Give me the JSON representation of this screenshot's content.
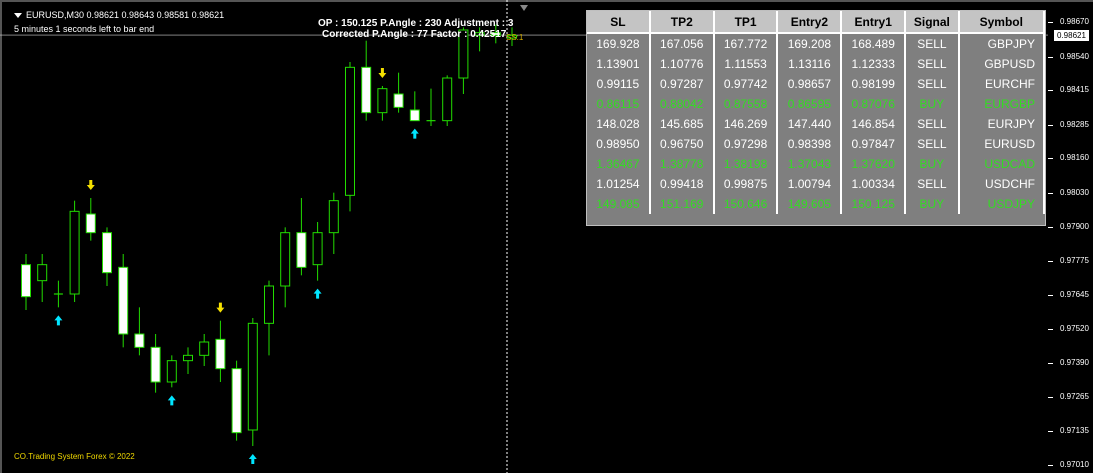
{
  "header": {
    "symbol_line": "EURUSD,M30  0.98621  0.98643  0.98581  0.98621",
    "timer_line": "5 minutes 1 seconds left to bar end"
  },
  "info": {
    "op_line": "OP : 150.125   P.Angle : 230   Adjustment : 3",
    "corrected_line": "Corrected P.Angle : 77   Factor : 0.42517"
  },
  "ss_label": "SS:1",
  "copyright": "CO.Trading System Forex © 2022",
  "current_price": "0.98621",
  "price_axis": {
    "labels": [
      "0.98670",
      "0.98540",
      "0.98415",
      "0.98285",
      "0.98160",
      "0.98030",
      "0.97900",
      "0.97775",
      "0.97645",
      "0.97520",
      "0.97390",
      "0.97265",
      "0.97135",
      "0.97010"
    ]
  },
  "signal_table": {
    "headers": [
      "SL",
      "TP2",
      "TP1",
      "Entry2",
      "Entry1",
      "Signal",
      "Symbol"
    ],
    "rows": [
      {
        "type": "sell",
        "cells": [
          "169.928",
          "167.056",
          "167.772",
          "169.208",
          "168.489",
          "SELL",
          "GBPJPY"
        ]
      },
      {
        "type": "sell",
        "cells": [
          "1.13901",
          "1.10776",
          "1.11553",
          "1.13116",
          "1.12333",
          "SELL",
          "GBPUSD"
        ]
      },
      {
        "type": "sell",
        "cells": [
          "0.99115",
          "0.97287",
          "0.97742",
          "0.98657",
          "0.98199",
          "SELL",
          "EURCHF"
        ]
      },
      {
        "type": "buy",
        "cells": [
          "0.86115",
          "0.88042",
          "0.87558",
          "0.86595",
          "0.87076",
          "BUY",
          "EURGBP"
        ]
      },
      {
        "type": "sell",
        "cells": [
          "148.028",
          "145.685",
          "146.269",
          "147.440",
          "146.854",
          "SELL",
          "EURJPY"
        ]
      },
      {
        "type": "sell",
        "cells": [
          "0.98950",
          "0.96750",
          "0.97298",
          "0.98398",
          "0.97847",
          "SELL",
          "EURUSD"
        ]
      },
      {
        "type": "buy",
        "cells": [
          "1.36467",
          "1.38778",
          "1.38198",
          "1.37043",
          "1.37620",
          "BUY",
          "USDCAD"
        ]
      },
      {
        "type": "sell",
        "cells": [
          "1.01254",
          "0.99418",
          "0.99875",
          "1.00794",
          "1.00334",
          "SELL",
          "USDCHF"
        ]
      },
      {
        "type": "buy",
        "cells": [
          "149.085",
          "151.169",
          "150.646",
          "149.605",
          "150.125",
          "BUY",
          "USDJPY"
        ]
      }
    ]
  },
  "colors": {
    "bull_body": "#000000",
    "bear_body": "#ffffff",
    "wick": "#22dd00",
    "up_arrow": "#00e5ff",
    "down_arrow": "#f5e000",
    "grid_line": "#cfcfcf"
  },
  "chart_data": {
    "type": "candlestick",
    "title": "EURUSD,M30",
    "ylim": [
      0.9699,
      0.987
    ],
    "current_price": 0.98621,
    "candles": [
      {
        "o": 0.9776,
        "h": 0.978,
        "l": 0.9759,
        "c": 0.9764
      },
      {
        "o": 0.977,
        "h": 0.978,
        "l": 0.9762,
        "c": 0.9776
      },
      {
        "o": 0.9765,
        "h": 0.977,
        "l": 0.976,
        "c": 0.9765
      },
      {
        "o": 0.9765,
        "h": 0.98,
        "l": 0.9762,
        "c": 0.9796
      },
      {
        "o": 0.9795,
        "h": 0.9801,
        "l": 0.9785,
        "c": 0.9788
      },
      {
        "o": 0.9788,
        "h": 0.979,
        "l": 0.9768,
        "c": 0.9773
      },
      {
        "o": 0.9775,
        "h": 0.978,
        "l": 0.9745,
        "c": 0.975
      },
      {
        "o": 0.975,
        "h": 0.976,
        "l": 0.9742,
        "c": 0.9745
      },
      {
        "o": 0.9745,
        "h": 0.975,
        "l": 0.9728,
        "c": 0.9732
      },
      {
        "o": 0.9732,
        "h": 0.9742,
        "l": 0.973,
        "c": 0.974
      },
      {
        "o": 0.974,
        "h": 0.9745,
        "l": 0.9735,
        "c": 0.9742
      },
      {
        "o": 0.9742,
        "h": 0.975,
        "l": 0.9738,
        "c": 0.9747
      },
      {
        "o": 0.9748,
        "h": 0.9755,
        "l": 0.9732,
        "c": 0.9737
      },
      {
        "o": 0.9737,
        "h": 0.974,
        "l": 0.971,
        "c": 0.9713
      },
      {
        "o": 0.9714,
        "h": 0.9756,
        "l": 0.9708,
        "c": 0.9754
      },
      {
        "o": 0.9754,
        "h": 0.977,
        "l": 0.9742,
        "c": 0.9768
      },
      {
        "o": 0.9768,
        "h": 0.979,
        "l": 0.976,
        "c": 0.9788
      },
      {
        "o": 0.9788,
        "h": 0.9801,
        "l": 0.9772,
        "c": 0.9775
      },
      {
        "o": 0.9776,
        "h": 0.9792,
        "l": 0.977,
        "c": 0.9788
      },
      {
        "o": 0.9788,
        "h": 0.9803,
        "l": 0.978,
        "c": 0.98
      },
      {
        "o": 0.9802,
        "h": 0.9852,
        "l": 0.9796,
        "c": 0.985
      },
      {
        "o": 0.985,
        "h": 0.986,
        "l": 0.983,
        "c": 0.9833
      },
      {
        "o": 0.9833,
        "h": 0.9843,
        "l": 0.983,
        "c": 0.9842
      },
      {
        "o": 0.984,
        "h": 0.9848,
        "l": 0.9833,
        "c": 0.9835
      },
      {
        "o": 0.9834,
        "h": 0.9841,
        "l": 0.983,
        "c": 0.983
      },
      {
        "o": 0.983,
        "h": 0.9842,
        "l": 0.9828,
        "c": 0.983
      },
      {
        "o": 0.983,
        "h": 0.9847,
        "l": 0.9828,
        "c": 0.9846
      },
      {
        "o": 0.9846,
        "h": 0.9865,
        "l": 0.984,
        "c": 0.9864
      },
      {
        "o": 0.9862,
        "h": 0.9865,
        "l": 0.9856,
        "c": 0.9863
      },
      {
        "o": 0.9863,
        "h": 0.9866,
        "l": 0.9859,
        "c": 0.9862
      },
      {
        "o": 0.9861,
        "h": 0.9865,
        "l": 0.9858,
        "c": 0.9862
      }
    ],
    "up_arrows": [
      2,
      9,
      14,
      18,
      24
    ],
    "down_arrows": [
      4,
      12,
      22
    ]
  }
}
